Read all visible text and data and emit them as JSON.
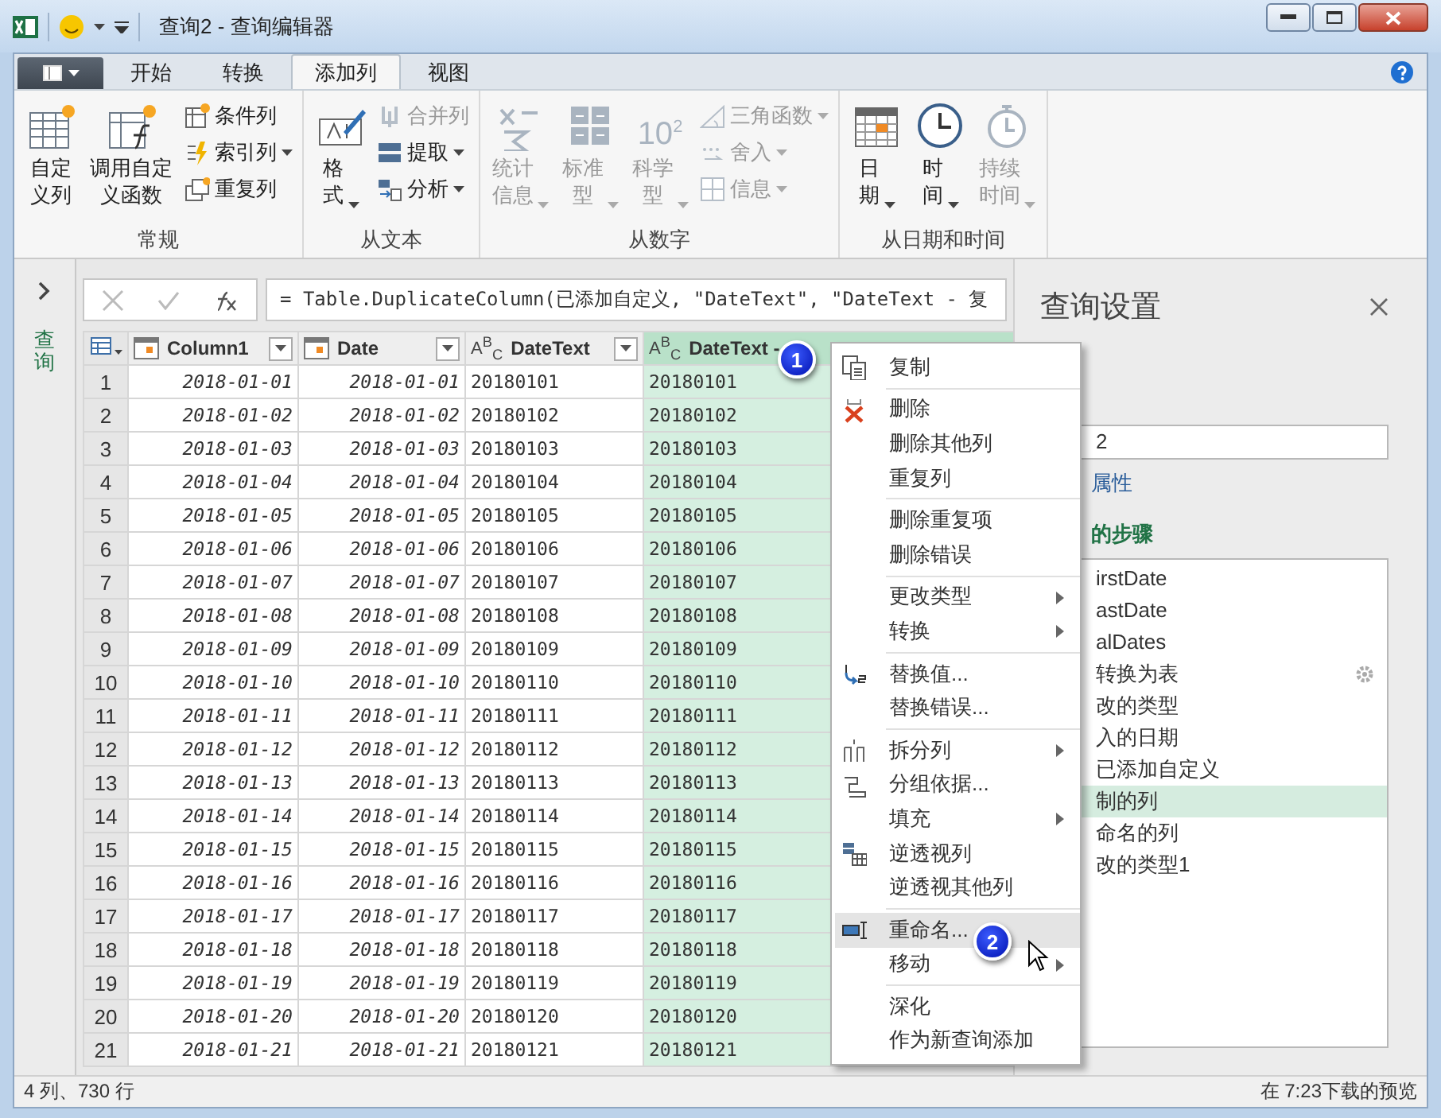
{
  "window": {
    "title": "查询2 - 查询编辑器"
  },
  "tabs": [
    {
      "label": "开始",
      "selected": false
    },
    {
      "label": "转换",
      "selected": false
    },
    {
      "label": "添加列",
      "selected": true
    },
    {
      "label": "视图",
      "selected": false
    }
  ],
  "ribbon": {
    "groups": [
      {
        "label": "常规",
        "large": [
          {
            "label": "自定义列",
            "kind": "custom-column",
            "disabled": false,
            "dropdown": false
          },
          {
            "label": "调用自定义函数",
            "kind": "function",
            "disabled": false,
            "dropdown": false
          }
        ],
        "small": [
          {
            "label": "条件列",
            "kind": "conditional",
            "disabled": false,
            "dropdown": false
          },
          {
            "label": "索引列",
            "kind": "index",
            "disabled": false,
            "dropdown": true
          },
          {
            "label": "重复列",
            "kind": "duplicate",
            "disabled": false,
            "dropdown": false
          }
        ]
      },
      {
        "label": "从文本",
        "large": [
          {
            "label": "格式",
            "kind": "format",
            "disabled": false,
            "dropdown": true
          }
        ],
        "small": [
          {
            "label": "合并列",
            "kind": "merge",
            "disabled": true,
            "dropdown": false
          },
          {
            "label": "提取",
            "kind": "extract",
            "disabled": false,
            "dropdown": true
          },
          {
            "label": "分析",
            "kind": "parse",
            "disabled": false,
            "dropdown": true
          }
        ]
      },
      {
        "label": "从数字",
        "large": [
          {
            "label": "统计信息",
            "kind": "statistics",
            "disabled": true,
            "dropdown": true
          },
          {
            "label": "标准型",
            "kind": "standard",
            "disabled": true,
            "dropdown": true
          },
          {
            "label": "科学型",
            "kind": "scientific",
            "icon_text": "10$^{2}$",
            "disabled": true,
            "dropdown": true
          }
        ],
        "small": [
          {
            "label": "三角函数",
            "kind": "trig",
            "disabled": true,
            "dropdown": true
          },
          {
            "label": "舍入",
            "kind": "round",
            "disabled": true,
            "dropdown": true
          },
          {
            "label": "信息",
            "kind": "info",
            "disabled": true,
            "dropdown": true
          }
        ]
      },
      {
        "label": "从日期和时间",
        "large": [
          {
            "label": "日期",
            "kind": "date",
            "disabled": false,
            "dropdown": true
          },
          {
            "label": "时间",
            "kind": "time",
            "disabled": false,
            "dropdown": true
          },
          {
            "label": "持续时间",
            "kind": "duration",
            "disabled": true,
            "dropdown": true
          }
        ]
      }
    ]
  },
  "queries_pane": {
    "label": "查询"
  },
  "formula_bar": {
    "formula": "= Table.DuplicateColumn(已添加自定义, \"DateText\", \"DateText - 复"
  },
  "table": {
    "columns": [
      {
        "name": "Column1",
        "kind": "date",
        "selected": false
      },
      {
        "name": "Date",
        "kind": "date",
        "selected": false
      },
      {
        "name": "DateText",
        "kind": "text",
        "type_label": "A$^{B}$$_{C}$",
        "selected": false
      },
      {
        "name": "DateText -",
        "kind": "text",
        "type_label": "A$^{B}$$_{C}$",
        "selected": true
      }
    ],
    "rows": [
      {
        "row_number": "1",
        "cells": [
          "2018-01-01",
          "2018-01-01",
          "20180101",
          "20180101"
        ]
      },
      {
        "row_number": "2",
        "cells": [
          "2018-01-02",
          "2018-01-02",
          "20180102",
          "20180102"
        ]
      },
      {
        "row_number": "3",
        "cells": [
          "2018-01-03",
          "2018-01-03",
          "20180103",
          "20180103"
        ]
      },
      {
        "row_number": "4",
        "cells": [
          "2018-01-04",
          "2018-01-04",
          "20180104",
          "20180104"
        ]
      },
      {
        "row_number": "5",
        "cells": [
          "2018-01-05",
          "2018-01-05",
          "20180105",
          "20180105"
        ]
      },
      {
        "row_number": "6",
        "cells": [
          "2018-01-06",
          "2018-01-06",
          "20180106",
          "20180106"
        ]
      },
      {
        "row_number": "7",
        "cells": [
          "2018-01-07",
          "2018-01-07",
          "20180107",
          "20180107"
        ]
      },
      {
        "row_number": "8",
        "cells": [
          "2018-01-08",
          "2018-01-08",
          "20180108",
          "20180108"
        ]
      },
      {
        "row_number": "9",
        "cells": [
          "2018-01-09",
          "2018-01-09",
          "20180109",
          "20180109"
        ]
      },
      {
        "row_number": "10",
        "cells": [
          "2018-01-10",
          "2018-01-10",
          "20180110",
          "20180110"
        ]
      },
      {
        "row_number": "11",
        "cells": [
          "2018-01-11",
          "2018-01-11",
          "20180111",
          "20180111"
        ]
      },
      {
        "row_number": "12",
        "cells": [
          "2018-01-12",
          "2018-01-12",
          "20180112",
          "20180112"
        ]
      },
      {
        "row_number": "13",
        "cells": [
          "2018-01-13",
          "2018-01-13",
          "20180113",
          "20180113"
        ]
      },
      {
        "row_number": "14",
        "cells": [
          "2018-01-14",
          "2018-01-14",
          "20180114",
          "20180114"
        ]
      },
      {
        "row_number": "15",
        "cells": [
          "2018-01-15",
          "2018-01-15",
          "20180115",
          "20180115"
        ]
      },
      {
        "row_number": "16",
        "cells": [
          "2018-01-16",
          "2018-01-16",
          "20180116",
          "20180116"
        ]
      },
      {
        "row_number": "17",
        "cells": [
          "2018-01-17",
          "2018-01-17",
          "20180117",
          "20180117"
        ]
      },
      {
        "row_number": "18",
        "cells": [
          "2018-01-18",
          "2018-01-18",
          "20180118",
          "20180118"
        ]
      },
      {
        "row_number": "19",
        "cells": [
          "2018-01-19",
          "2018-01-19",
          "20180119",
          "20180119"
        ]
      },
      {
        "row_number": "20",
        "cells": [
          "2018-01-20",
          "2018-01-20",
          "20180120",
          "20180120"
        ]
      },
      {
        "row_number": "21",
        "cells": [
          "2018-01-21",
          "2018-01-21",
          "20180121",
          "20180121"
        ]
      }
    ]
  },
  "query_settings": {
    "title": "查询设置",
    "name_value": "2",
    "properties_link": "属性",
    "steps_heading": "的步骤",
    "steps": [
      {
        "label": "irstDate",
        "selected": false,
        "settings": false
      },
      {
        "label": "astDate",
        "selected": false,
        "settings": false
      },
      {
        "label": "alDates",
        "selected": false,
        "settings": false
      },
      {
        "label": "转换为表",
        "selected": false,
        "settings": true
      },
      {
        "label": "改的类型",
        "selected": false,
        "settings": false
      },
      {
        "label": "入的日期",
        "selected": false,
        "settings": false
      },
      {
        "label": "已添加自定义",
        "selected": false,
        "settings": false
      },
      {
        "label": "制的列",
        "selected": true,
        "settings": false
      },
      {
        "label": "命名的列",
        "selected": false,
        "settings": false
      },
      {
        "label": "改的类型1",
        "selected": false,
        "settings": false
      }
    ]
  },
  "context_menu": {
    "groups": [
      [
        {
          "label": "复制",
          "kind": "copy",
          "submenu": false,
          "selected": false
        }
      ],
      [
        {
          "label": "删除",
          "kind": "delete",
          "submenu": false,
          "selected": false
        },
        {
          "label": "删除其他列",
          "kind": "none",
          "submenu": false,
          "selected": false
        },
        {
          "label": "重复列",
          "kind": "none",
          "submenu": false,
          "selected": false
        }
      ],
      [
        {
          "label": "删除重复项",
          "kind": "none",
          "submenu": false,
          "selected": false
        },
        {
          "label": "删除错误",
          "kind": "none",
          "submenu": false,
          "selected": false
        }
      ],
      [
        {
          "label": "更改类型",
          "kind": "none",
          "submenu": true,
          "selected": false
        },
        {
          "label": "转换",
          "kind": "none",
          "submenu": true,
          "selected": false
        }
      ],
      [
        {
          "label": "替换值...",
          "kind": "replace",
          "submenu": false,
          "selected": false
        },
        {
          "label": "替换错误...",
          "kind": "none",
          "submenu": false,
          "selected": false
        }
      ],
      [
        {
          "label": "拆分列",
          "kind": "split",
          "submenu": true,
          "selected": false
        },
        {
          "label": "分组依据...",
          "kind": "group",
          "submenu": false,
          "selected": false
        },
        {
          "label": "填充",
          "kind": "none",
          "submenu": true,
          "selected": false
        },
        {
          "label": "逆透视列",
          "kind": "unpivot",
          "submenu": false,
          "selected": false
        },
        {
          "label": "逆透视其他列",
          "kind": "none",
          "submenu": false,
          "selected": false
        }
      ],
      [
        {
          "label": "重命名...",
          "kind": "rename",
          "submenu": false,
          "selected": true
        },
        {
          "label": "移动",
          "kind": "none",
          "submenu": true,
          "selected": false
        }
      ],
      [
        {
          "label": "深化",
          "kind": "none",
          "submenu": false,
          "selected": false
        },
        {
          "label": "作为新查询添加",
          "kind": "none",
          "submenu": false,
          "selected": false
        }
      ]
    ]
  },
  "callouts": [
    "1",
    "2"
  ],
  "status_bar": {
    "left": "4 列、730 行",
    "right": "在 7:23下载的预览"
  }
}
